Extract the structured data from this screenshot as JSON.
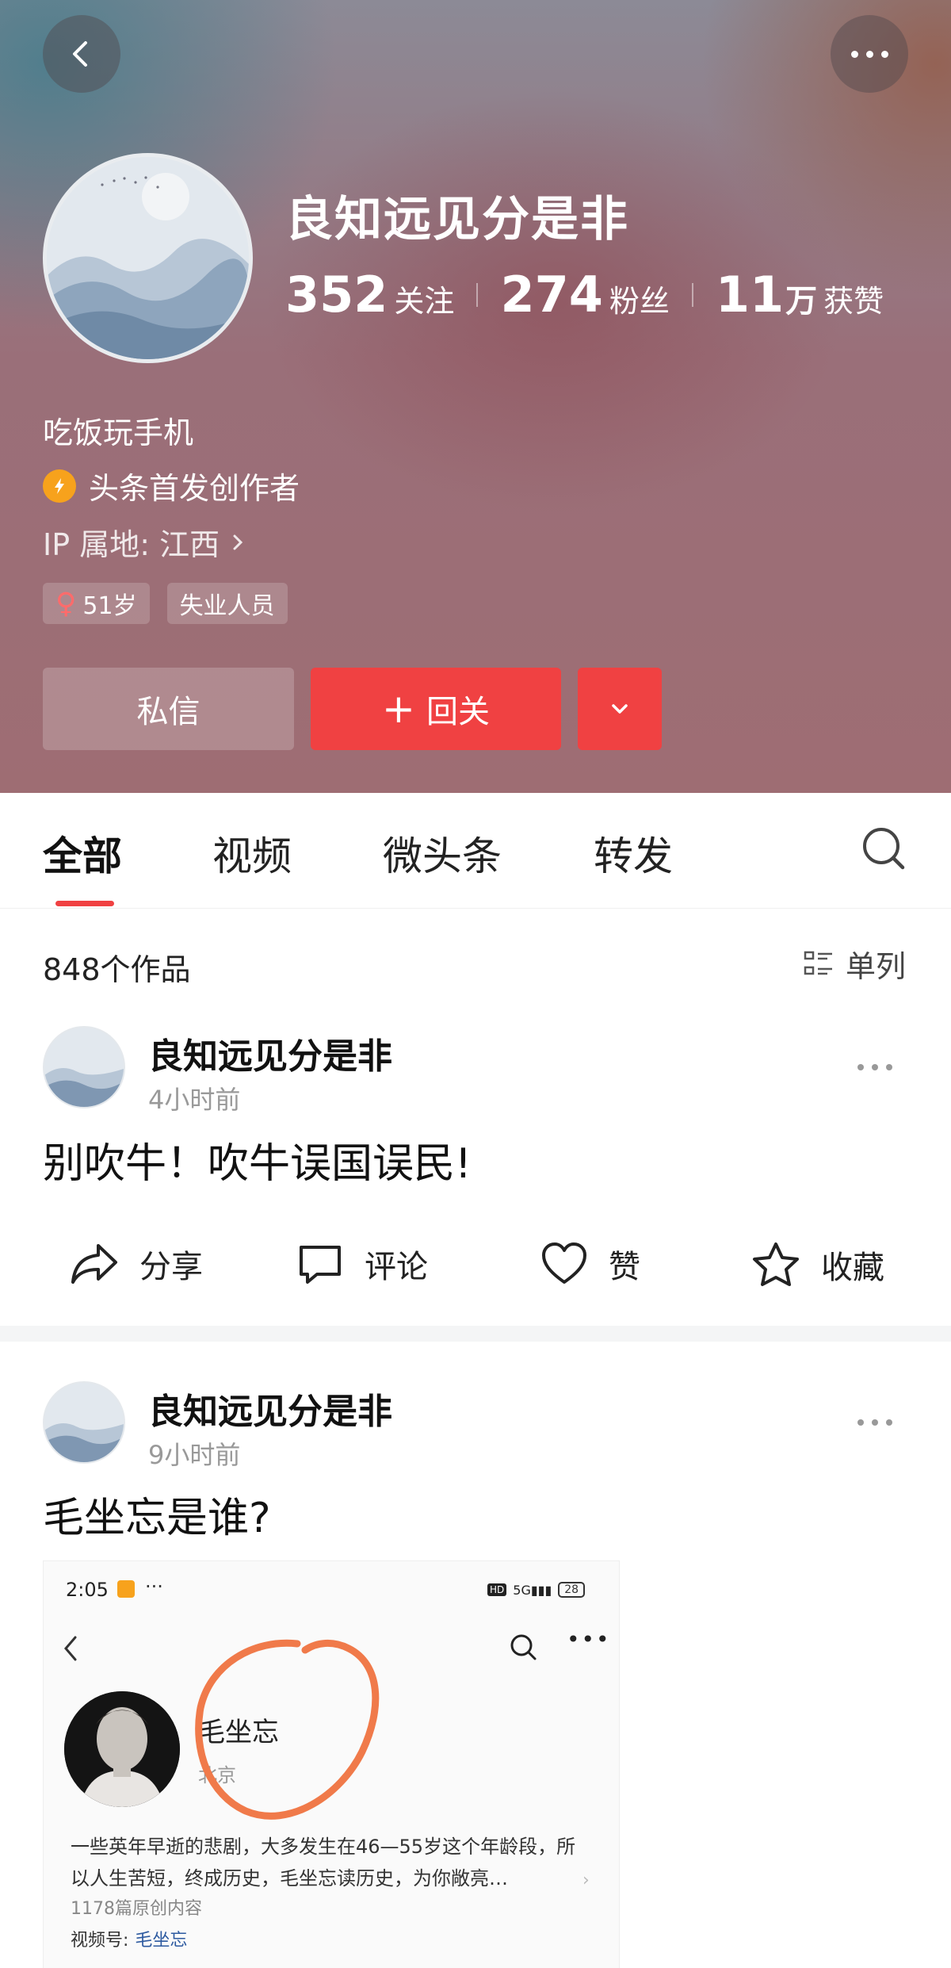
{
  "profile": {
    "name": "良知远见分是非",
    "stats": [
      {
        "num": "352",
        "unit": "",
        "label": "关注"
      },
      {
        "num": "274",
        "unit": "",
        "label": "粉丝"
      },
      {
        "num": "11",
        "unit": "万",
        "label": "获赞"
      }
    ],
    "bio": "吃饭玩手机",
    "badge": "头条首发创作者",
    "ip": "IP 属地: 江西",
    "tags": {
      "age": "51岁",
      "occupation": "失业人员"
    },
    "buttons": {
      "message": "私信",
      "follow_back": "回关"
    }
  },
  "tabs": [
    "全部",
    "视频",
    "微头条",
    "转发"
  ],
  "works": {
    "count": "848个作品",
    "layout_label": "单列"
  },
  "posts": [
    {
      "author": "良知远见分是非",
      "time": "4小时前",
      "text": "别吹牛！吹牛误国误民!"
    },
    {
      "author": "良知远见分是非",
      "time": "9小时前",
      "text": "毛坐忘是谁?"
    }
  ],
  "actions": {
    "share": "分享",
    "comment": "评论",
    "like": "赞",
    "favorite": "收藏"
  },
  "embed": {
    "time": "2:05",
    "battery": "28",
    "name": "毛坐忘",
    "location": "北京",
    "description": "一些英年早逝的悲剧，大多发生在46—55岁这个年龄段，所以人生苦短，终成历史，毛坐忘读历史，为你敞亮…",
    "content_count": "1178篇原创内容",
    "video_label": "视频号:",
    "video_name": "毛坐忘"
  },
  "colors": {
    "accent": "#f04142",
    "badge": "#f7a21c",
    "circle_annotation": "#f07a4a"
  }
}
